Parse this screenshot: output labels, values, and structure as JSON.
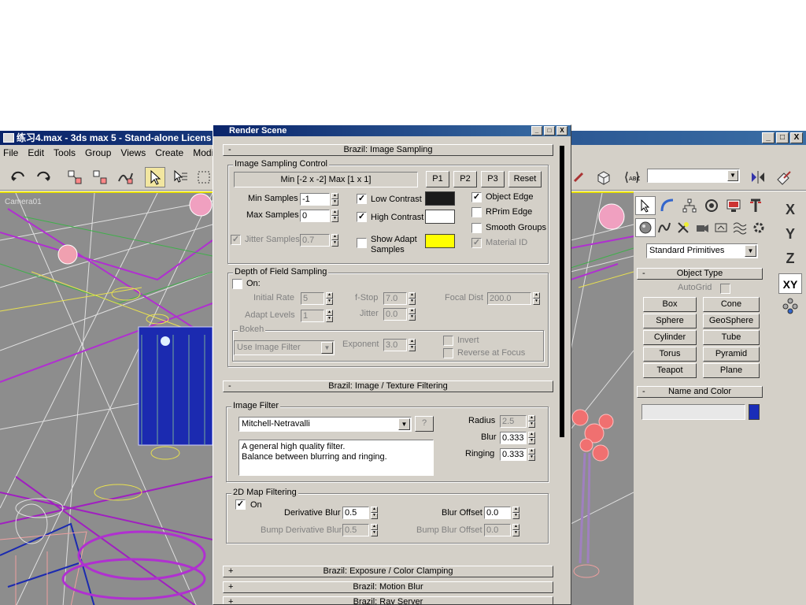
{
  "app": {
    "title": "练习4.max - 3ds max 5 - Stand-alone Licens",
    "window_buttons": [
      "_",
      "□",
      "X"
    ]
  },
  "menu": [
    "File",
    "Edit",
    "Tools",
    "Group",
    "Views",
    "Create",
    "Modifiers"
  ],
  "viewport_label": "Camera01",
  "command_panel": {
    "category": "Standard Primitives",
    "object_type_header": "Object Type",
    "autogrid_label": "AutoGrid",
    "buttons": [
      "Box",
      "Cone",
      "Sphere",
      "GeoSphere",
      "Cylinder",
      "Tube",
      "Torus",
      "Pyramid",
      "Teapot",
      "Plane"
    ],
    "name_color_header": "Name and Color",
    "object_color": "#1a2db8"
  },
  "axis": [
    "X",
    "Y",
    "Z",
    "XY"
  ],
  "dialog": {
    "title": "Render Scene",
    "window_buttons": [
      "_",
      "□",
      "X"
    ],
    "sampling": {
      "header": "Brazil: Image Sampling",
      "header_sign": "-",
      "group_label": "Image Sampling Control",
      "range_text": "Min [-2 x -2]  Max [1 x 1]",
      "presets": [
        "P1",
        "P2",
        "P3",
        "Reset"
      ],
      "min_samples_label": "Min Samples",
      "min_samples": "-1",
      "max_samples_label": "Max Samples",
      "max_samples": "0",
      "jitter_label": "Jitter Samples",
      "jitter_value": "0.7",
      "low_contrast": "Low Contrast",
      "high_contrast": "High Contrast",
      "show_adapt_1": "Show Adapt",
      "show_adapt_2": "Samples",
      "object_edge": "Object Edge",
      "rprim_edge": "RPrim Edge",
      "smooth_groups": "Smooth Groups",
      "material_id": "Material ID",
      "colors": {
        "low": "#1a1a1a",
        "high": "#ffffff",
        "adapt": "#ffff00"
      }
    },
    "dof": {
      "group_label": "Depth of Field Sampling",
      "on_label": "On:",
      "initial_rate_label": "Initial Rate",
      "initial_rate": "5",
      "fstop_label": "f-Stop",
      "fstop": "7.0",
      "focal_label": "Focal Dist",
      "focal": "200.0",
      "adapt_levels_label": "Adapt Levels",
      "adapt_levels": "1",
      "jitter_label": "Jitter",
      "jitter": "0.0",
      "bokeh_label": "Bokeh",
      "bokeh_select": "Use Image Filter",
      "exponent_label": "Exponent",
      "exponent": "3.0",
      "invert_label": "Invert",
      "reverse_label": "Reverse at Focus"
    },
    "filtering": {
      "header": "Brazil: Image / Texture Filtering",
      "header_sign": "-",
      "group_label": "Image Filter",
      "filter": "Mitchell-Netravalli",
      "help": "?",
      "desc_line1": "A general high quality filter.",
      "desc_line2": "Balance between blurring and ringing.",
      "radius_label": "Radius",
      "radius": "2.5",
      "blur_label": "Blur",
      "blur": "0.333",
      "ringing_label": "Ringing",
      "ringing": "0.333",
      "map_group_label": "2D Map Filtering",
      "on_label": "On",
      "deriv_blur_label": "Derivative Blur",
      "deriv_blur": "0.5",
      "blur_offset_label": "Blur Offset",
      "blur_offset": "0.0",
      "bump_deriv_label": "Bump Derivative Blur",
      "bump_deriv": "0.5",
      "bump_offset_label": "Bump Blur Offset",
      "bump_offset": "0.0"
    },
    "collapsed": [
      {
        "sign": "+",
        "label": "Brazil: Exposure / Color Clamping"
      },
      {
        "sign": "+",
        "label": "Brazil: Motion Blur"
      },
      {
        "sign": "+",
        "label": "Brazil: Ray Server"
      }
    ]
  }
}
